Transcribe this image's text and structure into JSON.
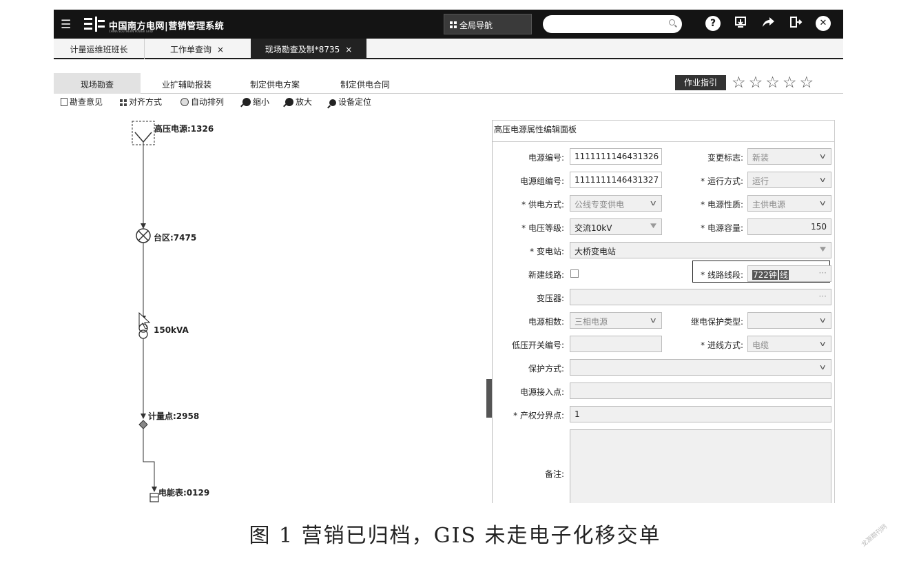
{
  "header": {
    "logo_text": "中国南方电网|营销管理系统",
    "logo_sub": "CHINA SOUTHERN POWER GRID",
    "nav_label": "全局导航",
    "search_placeholder": "",
    "icons": [
      "menu-icon",
      "help-icon",
      "download-icon",
      "share-icon",
      "exit-icon",
      "close-icon"
    ]
  },
  "tabs": [
    {
      "label": "计量运维班班长",
      "closable": false,
      "active": false
    },
    {
      "label": "工作单查询",
      "closable": true,
      "active": false
    },
    {
      "label": "现场勘查及制*8735",
      "closable": true,
      "active": true
    }
  ],
  "close_glyph": "×",
  "subtabs": [
    {
      "label": "现场勘查",
      "active": true
    },
    {
      "label": "业扩辅助报装",
      "active": false
    },
    {
      "label": "制定供电方案",
      "active": false
    },
    {
      "label": "制定供电合同",
      "active": false
    }
  ],
  "guide_label": "作业指引",
  "stars": "☆☆☆☆☆",
  "toolbar": [
    {
      "label": "勘查意见",
      "icon": "document-icon"
    },
    {
      "label": "对齐方式",
      "icon": "grid-icon"
    },
    {
      "label": "自动排列",
      "icon": "auto-icon"
    },
    {
      "label": "缩小",
      "icon": "zoom-out-icon"
    },
    {
      "label": "放大",
      "icon": "zoom-in-icon"
    },
    {
      "label": "设备定位",
      "icon": "locate-icon"
    }
  ],
  "diagram": {
    "nodes": [
      {
        "label": "高压电源:1326",
        "icon": "power-source-icon"
      },
      {
        "label": "台区:7475",
        "icon": "station-area-icon"
      },
      {
        "label": "150kVA",
        "icon": "transformer-icon"
      },
      {
        "label": "计量点:2958",
        "icon": "metering-point-icon"
      },
      {
        "label": "电能表:0129",
        "icon": "meter-icon"
      }
    ]
  },
  "panel": {
    "title": "高压电源属性编辑面板",
    "fields": {
      "power_no": {
        "label": "电源编号:",
        "value": "1111111146431326"
      },
      "change_flag": {
        "label": "变更标志:",
        "value": "新装"
      },
      "power_group_no": {
        "label": "电源组编号:",
        "value": "1111111146431327"
      },
      "run_mode": {
        "label": "* 运行方式:",
        "value": "运行"
      },
      "supply_mode": {
        "label": "* 供电方式:",
        "value": "公线专变供电"
      },
      "power_nature": {
        "label": "* 电源性质:",
        "value": "主供电源"
      },
      "voltage_level": {
        "label": "* 电压等级:",
        "value": "交流10kV"
      },
      "capacity": {
        "label": "* 电源容量:",
        "value": "150"
      },
      "substation": {
        "label": "* 变电站:",
        "value": "大桥变电站"
      },
      "new_line": {
        "label": "新建线路:",
        "checked": false
      },
      "line_section": {
        "label": "* 线路线段:",
        "value": "722钟",
        "value_tail": "线"
      },
      "transformer": {
        "label": "变压器:",
        "value": ""
      },
      "phase": {
        "label": "电源相数:",
        "value": "三相电源"
      },
      "relay_type": {
        "label": "继电保护类型:",
        "value": ""
      },
      "lv_switch": {
        "label": "低压开关编号:",
        "value": ""
      },
      "inlet_mode": {
        "label": "* 进线方式:",
        "value": "电缆"
      },
      "protect_mode": {
        "label": "保护方式:",
        "value": ""
      },
      "access_point": {
        "label": "电源接入点:",
        "value": ""
      },
      "property_boundary": {
        "label": "* 产权分界点:",
        "value": "1"
      },
      "remark": {
        "label": "备注:",
        "value": ""
      }
    }
  },
  "caption": "图 1 营销已归档，GIS 未走电子化移交单",
  "watermark": "龙源期刊网"
}
